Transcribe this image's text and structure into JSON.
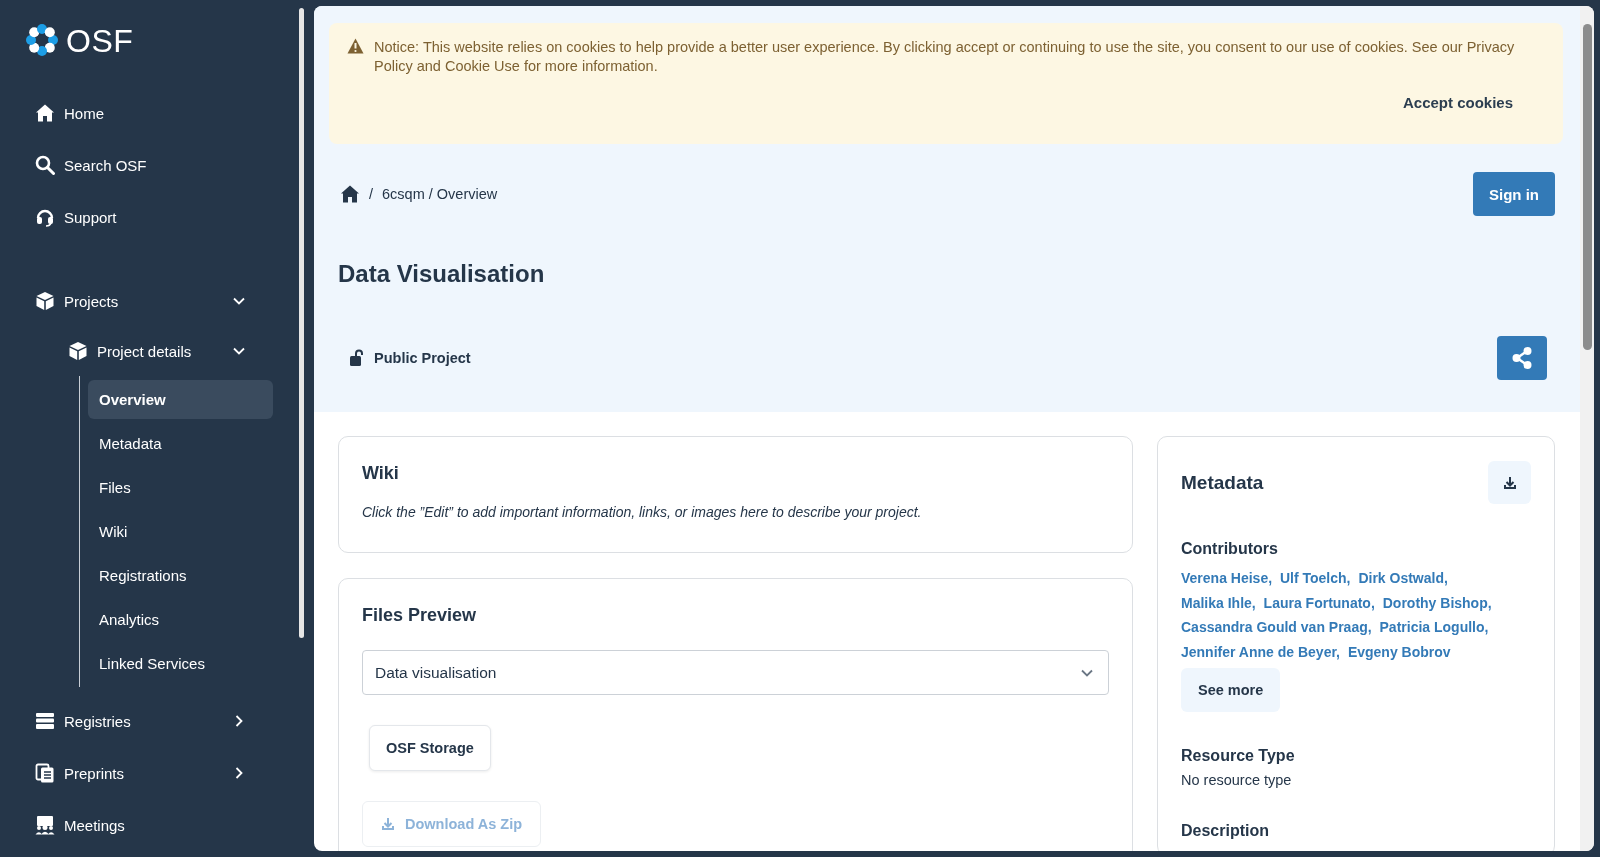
{
  "sidebar": {
    "logo_text": "OSF",
    "nav_top": [
      {
        "label": "Home"
      },
      {
        "label": "Search OSF"
      },
      {
        "label": "Support"
      }
    ],
    "nav_main": [
      {
        "label": "Projects",
        "expanded": true,
        "children": [
          {
            "label": "Project details",
            "expanded": true,
            "children": [
              {
                "label": "Overview",
                "selected": true
              },
              {
                "label": "Metadata",
                "selected": false
              },
              {
                "label": "Files",
                "selected": false
              },
              {
                "label": "Wiki",
                "selected": false
              },
              {
                "label": "Registrations",
                "selected": false
              },
              {
                "label": "Analytics",
                "selected": false
              },
              {
                "label": "Linked Services",
                "selected": false
              }
            ]
          }
        ]
      },
      {
        "label": "Registries",
        "expanded": false
      },
      {
        "label": "Preprints",
        "expanded": false
      },
      {
        "label": "Meetings"
      }
    ]
  },
  "cookie_banner": {
    "notice": "Notice: This website relies on cookies to help provide a better user experience. By clicking accept or continuing to use the site, you consent to our use of cookies. See our Privacy Policy and Cookie Use for more information.",
    "button": "Accept cookies"
  },
  "header": {
    "breadcrumb": [
      "/",
      "6csqm / Overview"
    ],
    "sign_in": "Sign in",
    "title": "Data Visualisation",
    "visibility": "Public Project"
  },
  "wiki": {
    "title": "Wiki",
    "text": "Click the ”Edit” to add important information, links, or images here to describe your project."
  },
  "files_preview": {
    "title": "Files Preview",
    "select_value": "Data visualisation",
    "storage_button": "OSF Storage",
    "download_button": {
      "label": "Download As Zip",
      "disabled": true
    }
  },
  "metadata": {
    "title": "Metadata",
    "contributors_heading": "Contributors",
    "contributors": [
      "Verena Heise,",
      "Ulf Toelch,",
      "Dirk Ostwald,",
      "Malika Ihle,",
      "Laura Fortunato,",
      "Dorothy Bishop,",
      "Cassandra Gould van Praag,",
      "Patricia Logullo,",
      "Jennifer Anne de Beyer,",
      "Evgeny Bobrov"
    ],
    "see_more": "See more",
    "resource_type_heading": "Resource Type",
    "resource_type": "No resource type",
    "description_heading": "Description"
  }
}
